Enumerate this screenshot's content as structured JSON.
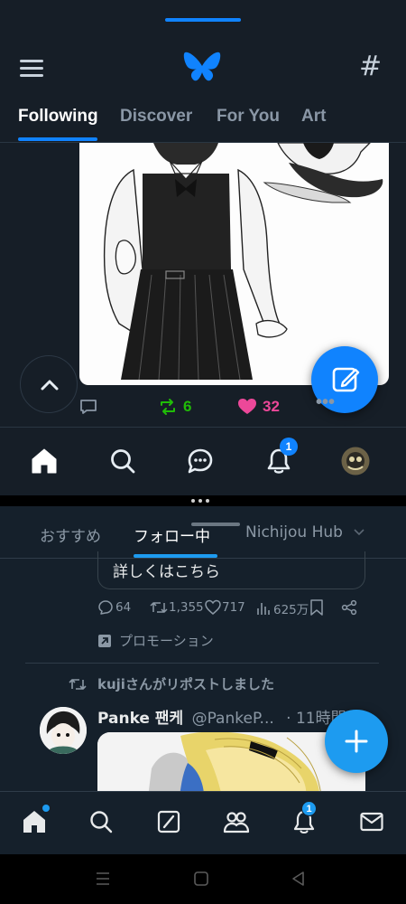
{
  "top_app": {
    "tabs": [
      {
        "label": "Following",
        "active": true
      },
      {
        "label": "Discover",
        "active": false
      },
      {
        "label": "For You",
        "active": false
      },
      {
        "label": "Art",
        "active": false
      }
    ],
    "post": {
      "reposts": "6",
      "likes": "32"
    },
    "nav": {
      "notifications_badge": "1"
    },
    "colors": {
      "accent": "#1083fe",
      "repost": "#20bc07",
      "like": "#ec4899"
    },
    "icons": {
      "logo": "butterfly-icon",
      "menu": "hamburger-icon",
      "feeds": "hash-icon"
    }
  },
  "bottom_app": {
    "tabs": [
      {
        "label": "おすすめ",
        "active": false
      },
      {
        "label": "フォロー中",
        "active": true
      },
      {
        "label": "Nichijou Hub",
        "active": false
      }
    ],
    "ad": {
      "learn_more": "詳しくはこちら",
      "replies": "64",
      "reposts": "1,355",
      "likes": "717",
      "views": "625万",
      "promotion_label": "プロモーション"
    },
    "tweet": {
      "repost_notice": "kujiさんがリポストしました",
      "author_name": "Panke 팬케",
      "author_handle": "@PankeP...",
      "time": "· 11時間"
    },
    "nav": {
      "notifications_badge": "1"
    },
    "colors": {
      "accent": "#1d9bf0"
    }
  }
}
